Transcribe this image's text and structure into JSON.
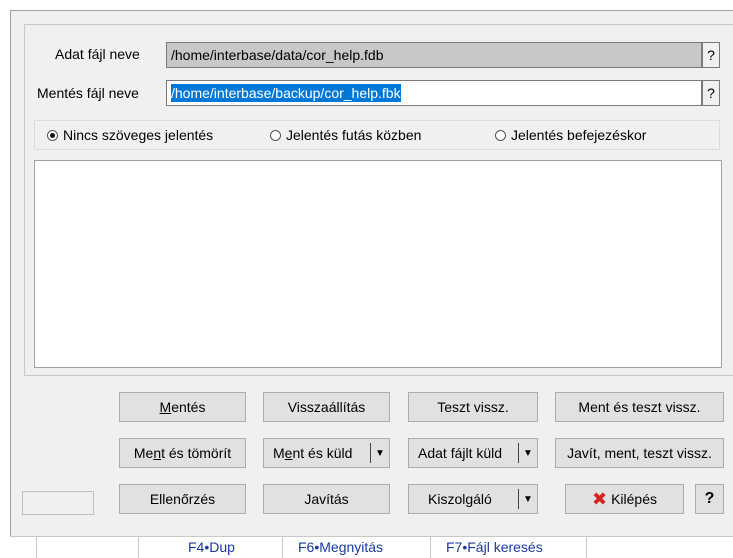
{
  "form": {
    "data_file_label": "Adat fájl neve",
    "data_file_value": "/home/interbase/data/cor_help.fdb",
    "backup_file_label": "Mentés fájl neve",
    "backup_file_value": "/home/interbase/backup/cor_help.fbk",
    "help_button": "?"
  },
  "report_options": {
    "options": [
      {
        "label": "Nincs szöveges jelentés",
        "selected": true
      },
      {
        "label": "Jelentés futás közben",
        "selected": false
      },
      {
        "label": "Jelentés befejezéskor",
        "selected": false
      }
    ]
  },
  "log": {
    "text": ""
  },
  "buttons": {
    "mentes": "Mentés",
    "visszaallitas": "Visszaállítás",
    "teszt_vissz": "Teszt vissz.",
    "ment_es_teszt": "Ment és teszt vissz.",
    "ment_es_tomorit": "Ment és tömörít",
    "ment_es_kuld": "Ment és küld",
    "adat_fajlt_kuld": "Adat fájlt küld",
    "javit_ment_teszt": "Javít, ment, teszt vissz.",
    "ellenorzes": "Ellenőrzés",
    "javitas": "Javítás",
    "kiszolgalo": "Kiszolgáló",
    "kilepes": "Kilépés",
    "help": "?",
    "dropdown_arrow": "▼"
  },
  "statusbar": {
    "f4": "F4•Dup",
    "f6": "F6•Megnyitás",
    "f7": "F7•Fájl keresés"
  },
  "icons": {
    "exit": "x-icon",
    "exit_color": "#d32424"
  }
}
